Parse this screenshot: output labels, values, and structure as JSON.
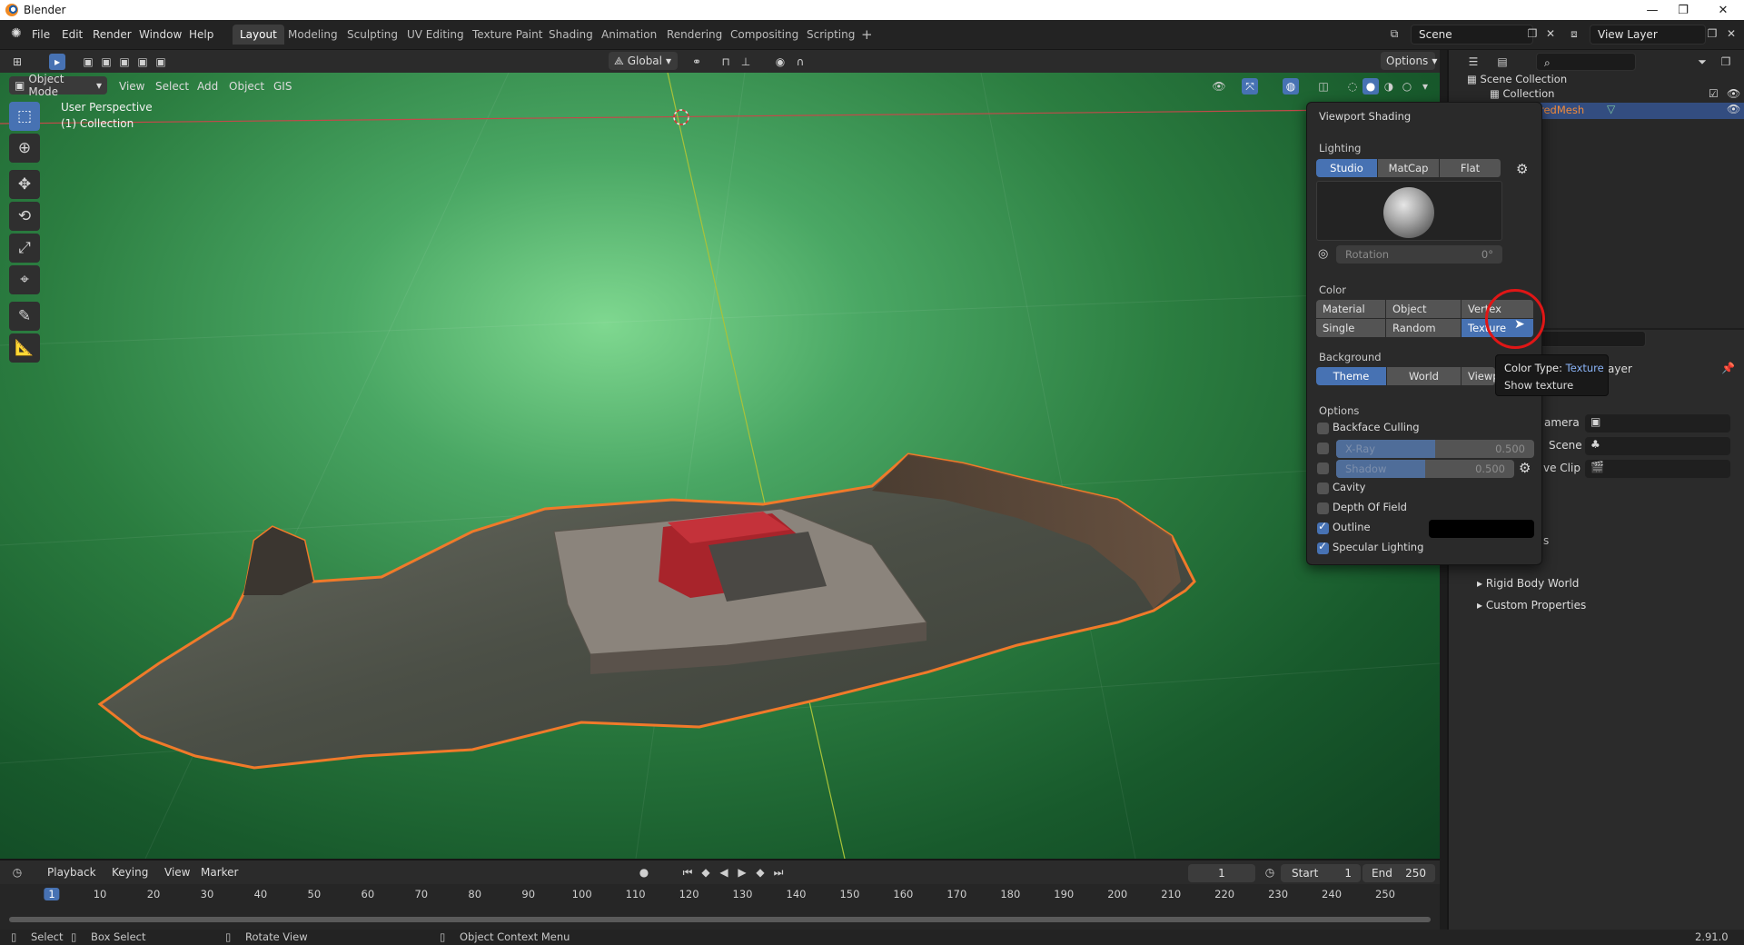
{
  "window": {
    "title": "Blender",
    "controls": [
      "—",
      "❐",
      "✕"
    ]
  },
  "topbar": {
    "menus": [
      "File",
      "Edit",
      "Render",
      "Window",
      "Help"
    ],
    "workspaces": [
      "Layout",
      "Modeling",
      "Sculpting",
      "UV Editing",
      "Texture Paint",
      "Shading",
      "Animation",
      "Rendering",
      "Compositing",
      "Scripting"
    ],
    "active_workspace": "Layout",
    "add_workspace": "+",
    "scene": "Scene",
    "view_layer": "View Layer"
  },
  "viewport_header": {
    "mode": "Object Mode",
    "menus": [
      "View",
      "Select",
      "Add",
      "Object",
      "GIS"
    ],
    "transform_orientation": "Global",
    "options": "Options"
  },
  "viewport": {
    "perspective": "User Perspective",
    "collection": "(1) Collection",
    "tools": [
      "select-box",
      "cursor",
      "move",
      "rotate",
      "scale",
      "transform",
      "annotate",
      "measure"
    ]
  },
  "shading": {
    "title": "Viewport Shading",
    "lighting_label": "Lighting",
    "lighting": [
      "Studio",
      "MatCap",
      "Flat"
    ],
    "lighting_active": "Studio",
    "rotation_label": "Rotation",
    "rotation_value": "0°",
    "color_label": "Color",
    "color_row1": [
      "Material",
      "Object",
      "Vertex"
    ],
    "color_row2": [
      "Single",
      "Random",
      "Texture"
    ],
    "color_active": "Texture",
    "background_label": "Background",
    "background": [
      "Theme",
      "World",
      "Viewport"
    ],
    "background_active": "Theme",
    "options_label": "Options",
    "backface_culling": "Backface Culling",
    "xray_label": "X-Ray",
    "xray_value": "0.500",
    "xray_fraction": 0.5,
    "shadow_label": "Shadow",
    "shadow_value": "0.500",
    "shadow_fraction": 0.5,
    "cavity": "Cavity",
    "depth_of_field": "Depth Of Field",
    "outline": "Outline",
    "outline_checked": true,
    "specular": "Specular Lighting",
    "specular_checked": true
  },
  "tooltip": {
    "line1_prefix": "Color Type:",
    "line1_value": "Texture",
    "line2": "Show texture"
  },
  "outliner": {
    "root": "Scene Collection",
    "collection": "Collection",
    "object": "redMesh"
  },
  "properties": {
    "header_suffix": "ayer",
    "camera_label": "amera",
    "scene_label": "Scene",
    "clip_label": "ve Clip",
    "ellipsis": "s",
    "panels": [
      "Rigid Body World",
      "Custom Properties"
    ]
  },
  "timeline": {
    "menus": [
      "Playback",
      "Keying",
      "View",
      "Marker"
    ],
    "current_frame": "1",
    "start_label": "Start",
    "start": "1",
    "end_label": "End",
    "end": "250",
    "ticks": [
      "1",
      "10",
      "20",
      "30",
      "40",
      "50",
      "60",
      "70",
      "80",
      "90",
      "100",
      "110",
      "120",
      "130",
      "140",
      "150",
      "160",
      "170",
      "180",
      "190",
      "200",
      "210",
      "220",
      "230",
      "240",
      "250"
    ]
  },
  "statusbar": {
    "select": "Select",
    "box_select": "Box Select",
    "rotate_view": "Rotate View",
    "context_menu": "Object Context Menu",
    "version": "2.91.0"
  },
  "colors": {
    "accent": "#4772b3",
    "selection_outline": "#f07a2a",
    "background_green": "#2b7d40"
  }
}
